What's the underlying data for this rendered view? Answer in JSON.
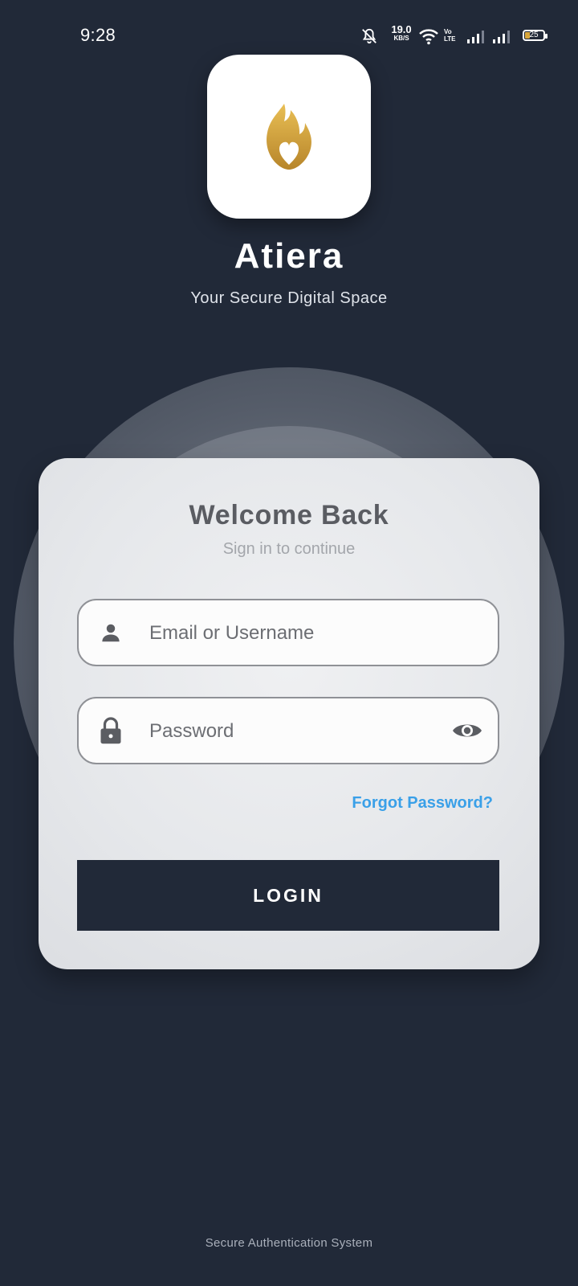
{
  "status_bar": {
    "time": "9:28",
    "net_speed": "19.0",
    "net_speed_unit": "KB/S",
    "volte_top": "Vo",
    "volte_bottom": "LTE",
    "battery": "25",
    "icons": [
      "notifications-off-icon",
      "wifi-icon",
      "signal-icon",
      "signal-icon",
      "battery-icon"
    ]
  },
  "app": {
    "name": "Atiera",
    "tagline": "Your Secure Digital Space",
    "logo_icon": "flame-heart-logo"
  },
  "login": {
    "title": "Welcome Back",
    "subtitle": "Sign in to continue",
    "username_placeholder": "Email or Username",
    "password_placeholder": "Password",
    "forgot_password": "Forgot Password?",
    "button": "LOGIN"
  },
  "footer": "Secure Authentication System",
  "colors": {
    "background": "#212938",
    "accent_link": "#3aa0e8",
    "logo_gold": "#d9a63a",
    "button": "#212938"
  }
}
